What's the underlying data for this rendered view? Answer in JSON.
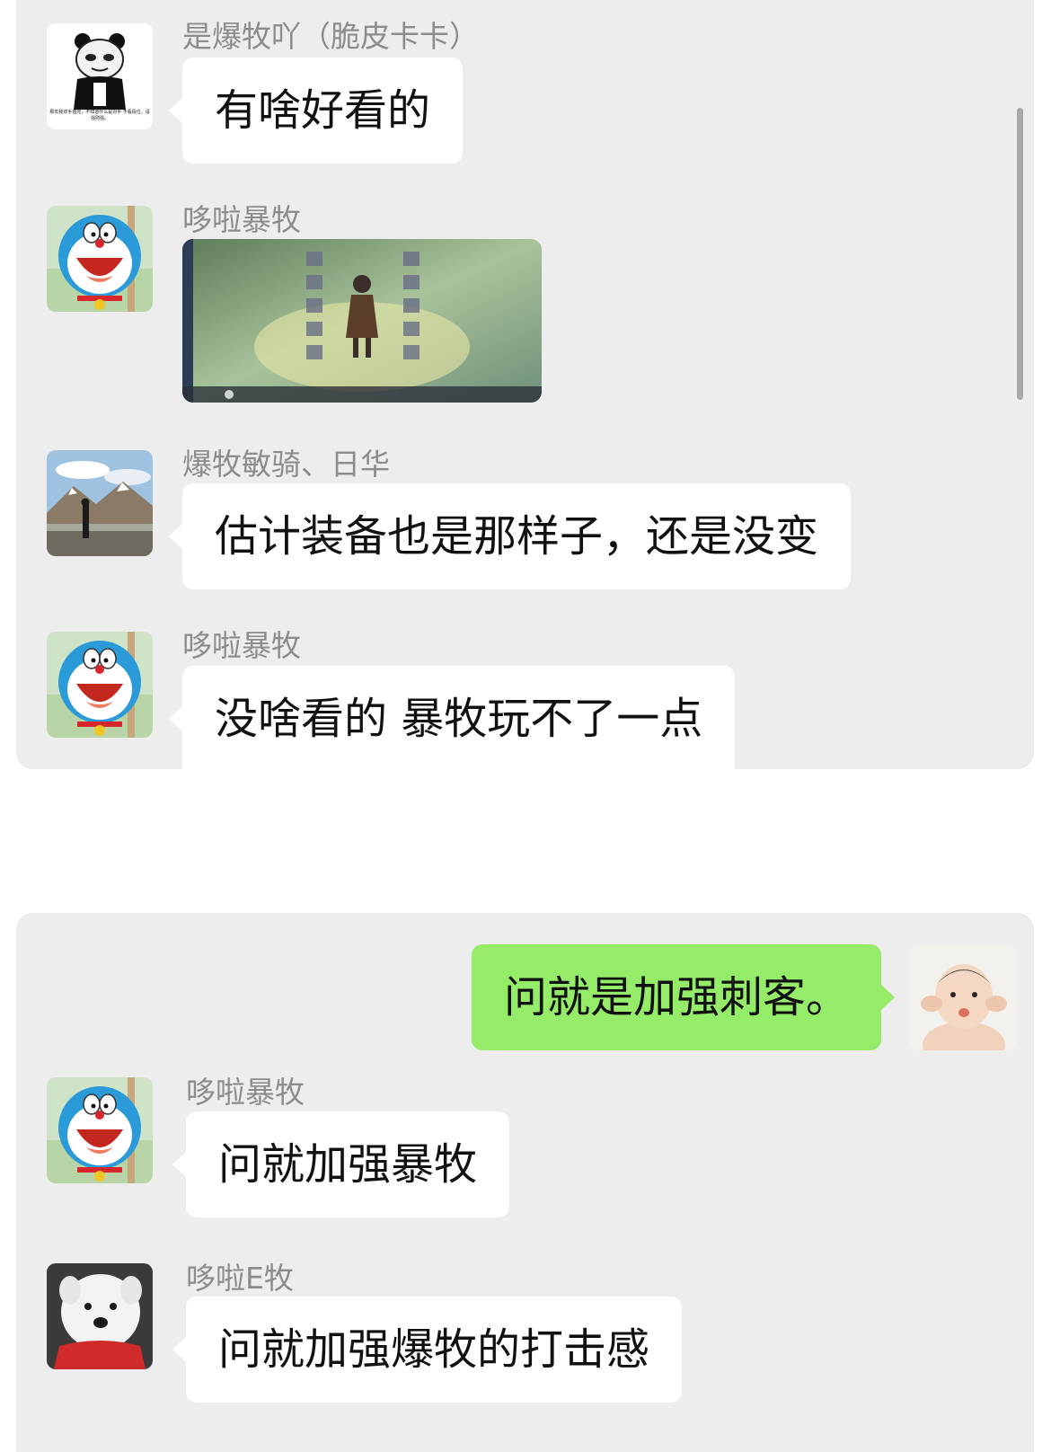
{
  "chat_top": {
    "messages": [
      {
        "sender": "是爆牧吖（脆皮卡卡）",
        "text": "有啥好看的",
        "avatar_icon": "panda-meme-icon",
        "avatar_caption": "那年我双手插兜，不知道什么是对手 不看段位，请强则强。"
      },
      {
        "sender": "哆啦暴牧",
        "image": "game-screenshot-image",
        "avatar_icon": "doraemon-icon"
      },
      {
        "sender": "爆牧敏骑、日华",
        "text": "估计装备也是那样子，还是没变",
        "avatar_icon": "mountain-landscape-icon"
      },
      {
        "sender": "哆啦暴牧",
        "text": "没啥看的  暴牧玩不了一点",
        "avatar_icon": "doraemon-icon"
      }
    ]
  },
  "chat_bottom": {
    "messages": [
      {
        "direction": "outgoing",
        "text": "问就是加强刺客。",
        "avatar_icon": "baby-photo-icon"
      },
      {
        "sender": "哆啦暴牧",
        "text": "问就加强暴牧",
        "avatar_icon": "doraemon-icon"
      },
      {
        "sender": "哆啦E牧",
        "text": "问就加强爆牧的打击感",
        "avatar_icon": "white-dog-icon"
      }
    ]
  },
  "colors": {
    "chat_background": "#ededed",
    "incoming_bubble": "#ffffff",
    "outgoing_bubble": "#95ec69",
    "sender_name": "#8c8c8c"
  }
}
